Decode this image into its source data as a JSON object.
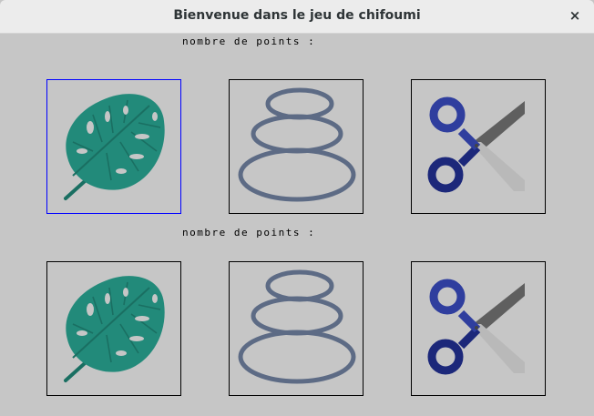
{
  "window": {
    "title": "Bienvenue dans le jeu de chifoumi",
    "close_glyph": "×"
  },
  "player1": {
    "score_label": "nombre de points :",
    "choices": [
      {
        "icon": "leaf-icon",
        "selected": true
      },
      {
        "icon": "stones-icon",
        "selected": false
      },
      {
        "icon": "scissors-icon",
        "selected": false
      }
    ]
  },
  "player2": {
    "score_label": "nombre de points :",
    "choices": [
      {
        "icon": "leaf-icon",
        "selected": false
      },
      {
        "icon": "stones-icon",
        "selected": false
      },
      {
        "icon": "scissors-icon",
        "selected": false
      }
    ]
  },
  "colors": {
    "leaf": "#228a7a",
    "stone": "#5d6b85",
    "scissors_handle": "#2f3e9e",
    "blade_light": "#b9b9b9",
    "blade_dark": "#5f5f5f",
    "selection": "#0000ff"
  }
}
